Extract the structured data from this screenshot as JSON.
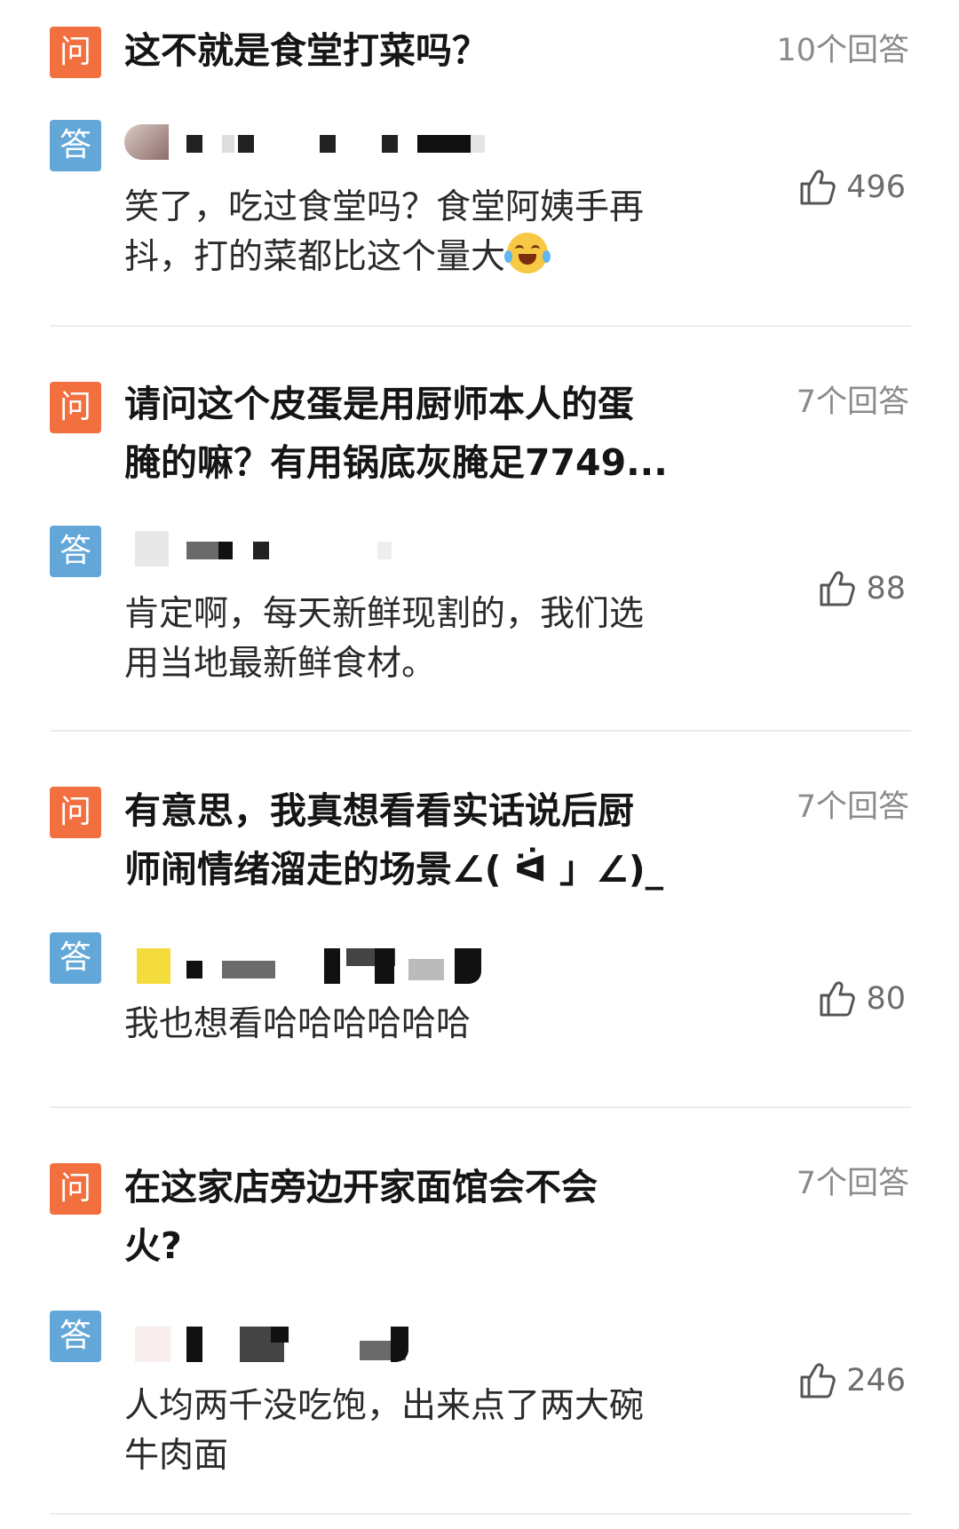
{
  "labels": {
    "question_badge": "问",
    "answer_badge": "答"
  },
  "items": [
    {
      "question": [
        "这不就是食堂打菜吗？"
      ],
      "answer_count": "10个回答",
      "answer": [
        "笑了，吃过食堂吗？食堂阿姨手再",
        "抖，打的菜都比这个量大"
      ],
      "emoji": "crying-laughing-emoji",
      "likes": "496"
    },
    {
      "question": [
        "请问这个皮蛋是用厨师本人的蛋",
        "腌的嘛？有用锅底灰腌足7749..."
      ],
      "answer_count": "7个回答",
      "answer": [
        "肯定啊，每天新鲜现割的，我们选",
        "用当地最新鲜食材。"
      ],
      "likes": "88"
    },
    {
      "question": [
        "有意思，我真想看看实话说后厨",
        "师闹情绪溜走的场景∠( ᐛ 」∠)_"
      ],
      "answer_count": "7个回答",
      "answer": [
        "我也想看哈哈哈哈哈哈"
      ],
      "likes": "80"
    },
    {
      "question": [
        "在这家店旁边开家面馆会不会",
        "火?"
      ],
      "answer_count": "7个回答",
      "answer": [
        "人均两千没吃饱，出来点了两大碗",
        "牛肉面"
      ],
      "likes": "246"
    }
  ],
  "colors": {
    "question_badge": "#f2703f",
    "answer_badge": "#62a7d8",
    "muted": "#8b8b8b"
  }
}
